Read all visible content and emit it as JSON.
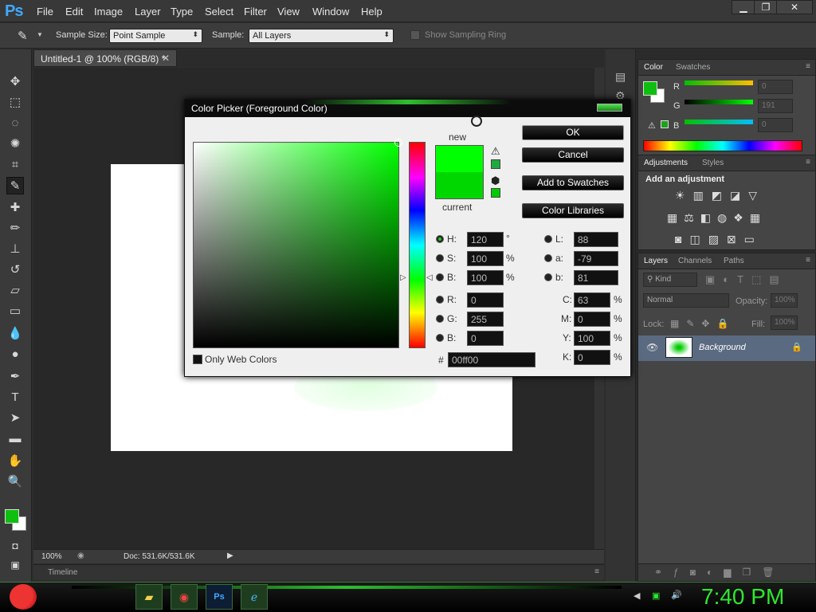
{
  "app": {
    "logo": "Ps"
  },
  "menu": [
    "File",
    "Edit",
    "Image",
    "Layer",
    "Type",
    "Select",
    "Filter",
    "View",
    "Window",
    "Help"
  ],
  "window_controls": [
    "minimize",
    "restore",
    "close"
  ],
  "options_bar": {
    "sample_size_label": "Sample Size:",
    "sample_size_value": "Point Sample",
    "sample_label": "Sample:",
    "sample_value": "All Layers",
    "sampling_ring_label": "Show Sampling Ring"
  },
  "document": {
    "tab_title": "Untitled-1 @ 100% (RGB/8) *",
    "zoom": "100%",
    "doc_info": "Doc: 531.6K/531.6K",
    "timeline_label": "Timeline"
  },
  "color_panel": {
    "tabs": [
      "Color",
      "Swatches"
    ],
    "r_label": "R",
    "g_label": "G",
    "b_label": "B",
    "r_value": "0",
    "g_value": "191",
    "b_value": "0"
  },
  "adjustments_panel": {
    "tabs": [
      "Adjustments",
      "Styles"
    ],
    "heading": "Add an adjustment"
  },
  "layers_panel": {
    "tabs": [
      "Layers",
      "Channels",
      "Paths"
    ],
    "filter_kind": "Kind",
    "blend_mode": "Normal",
    "opacity_label": "Opacity:",
    "opacity_value": "100%",
    "lock_label": "Lock:",
    "fill_label": "Fill:",
    "fill_value": "100%",
    "layer_name": "Background"
  },
  "color_picker": {
    "title": "Color Picker (Foreground Color)",
    "new_label": "new",
    "current_label": "current",
    "buttons": {
      "ok": "OK",
      "cancel": "Cancel",
      "add_swatches": "Add to Swatches",
      "color_libraries": "Color Libraries"
    },
    "hsb": {
      "h_label": "H:",
      "h_value": "120",
      "h_unit": "°",
      "s_label": "S:",
      "s_value": "100",
      "s_unit": "%",
      "b_label": "B:",
      "b_value": "100",
      "b_unit": "%"
    },
    "rgb": {
      "r_label": "R:",
      "r_value": "0",
      "g_label": "G:",
      "g_value": "255",
      "b_label": "B:",
      "b_value": "0"
    },
    "lab": {
      "l_label": "L:",
      "l_value": "88",
      "a_label": "a:",
      "a_value": "-79",
      "b_label": "b:",
      "b_value": "81"
    },
    "cmyk": {
      "c_label": "C:",
      "c_value": "63",
      "m_label": "M:",
      "m_value": "0",
      "y_label": "Y:",
      "y_value": "100",
      "k_label": "K:",
      "k_value": "0",
      "unit": "%"
    },
    "hex_label": "#",
    "hex_value": "00ff00",
    "only_web_colors": "Only Web Colors",
    "new_color": "#00ff00",
    "current_color": "#00d700"
  },
  "foreground_color": "#0fbf0f",
  "background_color": "#ffffff",
  "taskbar": {
    "clock": "7:40 PM",
    "apps": [
      "folder-icon",
      "chrome-icon",
      "photoshop-icon",
      "ie-icon"
    ]
  }
}
